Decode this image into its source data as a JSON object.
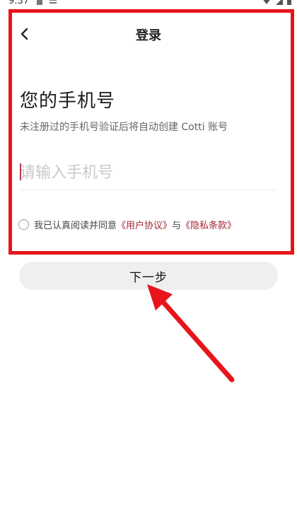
{
  "status_bar": {
    "time": "9:37"
  },
  "header": {
    "title": "登录",
    "back_icon": "chevron-left-icon"
  },
  "login": {
    "headline": "您的手机号",
    "subtext": "未注册过的手机号验证后将自动创建 Cotti 账号",
    "phone_input": {
      "value": "",
      "placeholder": "请输入手机号"
    }
  },
  "agreement": {
    "checked": false,
    "prefix": "我已认真阅读并同意",
    "user_agreement_link": "《用户协议》",
    "joiner": "与",
    "privacy_link": "《隐私条款》"
  },
  "actions": {
    "next_label": "下一步"
  },
  "annotation": {
    "highlight_color": "#e8141c",
    "arrow_color": "#e8141c"
  },
  "colors": {
    "link": "#a32634",
    "button_bg": "#efefef",
    "placeholder": "#c9c9c9"
  }
}
